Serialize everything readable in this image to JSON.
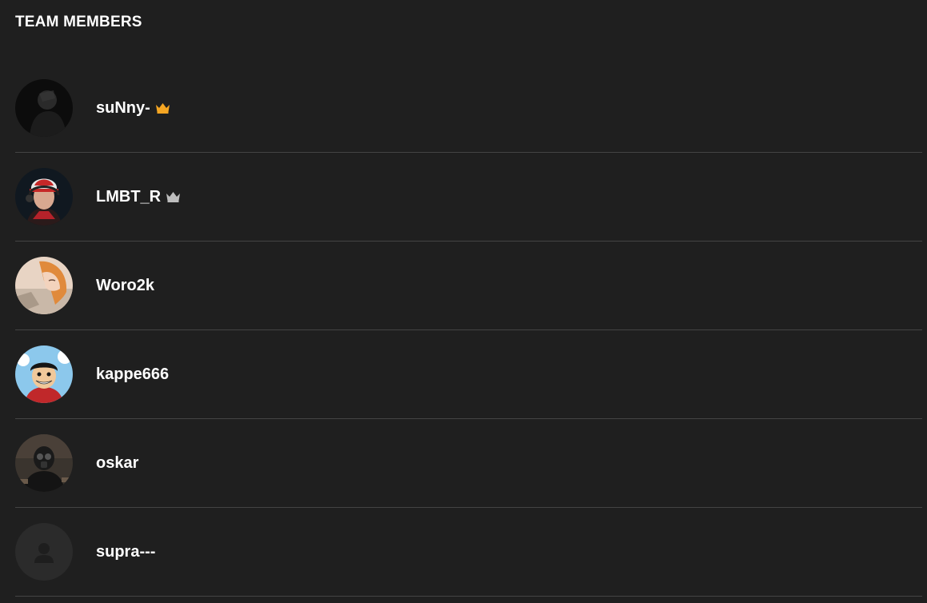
{
  "header": {
    "title": "TEAM MEMBERS"
  },
  "colors": {
    "background": "#1f1f1f",
    "divider": "#444444",
    "crown_leader": "#f5a623",
    "crown_co_leader": "#bdbdbd"
  },
  "members": [
    {
      "name": "suNny-",
      "crown": "gold",
      "avatar": "dark-portrait"
    },
    {
      "name": "LMBT_R",
      "crown": "silver",
      "avatar": "red-cap-headset-portrait"
    },
    {
      "name": "Woro2k",
      "crown": null,
      "avatar": "orange-hair-anime"
    },
    {
      "name": "kappe666",
      "crown": null,
      "avatar": "straw-hat-anime"
    },
    {
      "name": "oskar",
      "crown": null,
      "avatar": "gas-mask-soldier"
    },
    {
      "name": "supra---",
      "crown": null,
      "avatar": "default-user"
    }
  ]
}
